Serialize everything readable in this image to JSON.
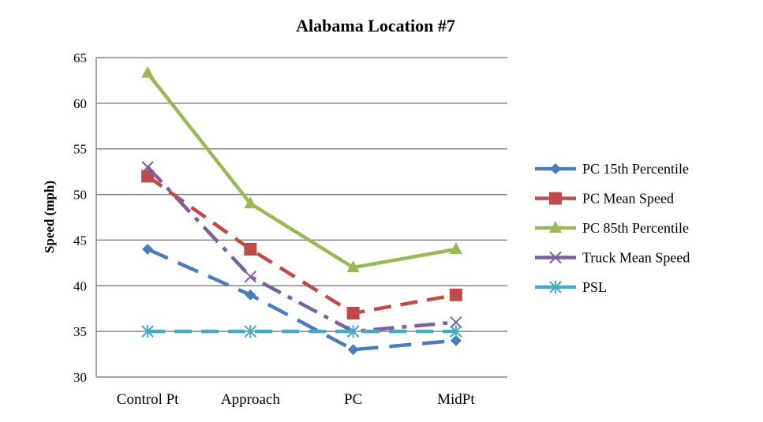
{
  "chart_data": {
    "type": "line",
    "title": "Alabama Location #7",
    "xlabel": "",
    "ylabel": "Speed (mph)",
    "ylim": [
      30,
      65
    ],
    "yticks": [
      30,
      35,
      40,
      45,
      50,
      55,
      60,
      65
    ],
    "grid": true,
    "legend_position": "right",
    "categories": [
      "Control Pt",
      "Approach",
      "PC",
      "MidPt"
    ],
    "series": [
      {
        "name": "PC 15th Percentile",
        "color": "#4a7ebb",
        "marker": "diamond",
        "dash": "long-dash",
        "values": [
          44,
          39,
          33,
          34
        ]
      },
      {
        "name": "PC Mean Speed",
        "color": "#be4b48",
        "marker": "square",
        "dash": "dash",
        "values": [
          52,
          44,
          37,
          39
        ]
      },
      {
        "name": "PC 85th Percentile",
        "color": "#98b954",
        "marker": "triangle",
        "dash": "solid",
        "values": [
          63.3,
          49,
          42,
          44
        ]
      },
      {
        "name": "Truck Mean Speed",
        "color": "#7d5fa0",
        "marker": "x",
        "dash": "dash-dot",
        "values": [
          53,
          41,
          35,
          36
        ]
      },
      {
        "name": "PSL",
        "color": "#46aac5",
        "marker": "star",
        "dash": "dash",
        "values": [
          35,
          35,
          35,
          35
        ]
      }
    ]
  }
}
